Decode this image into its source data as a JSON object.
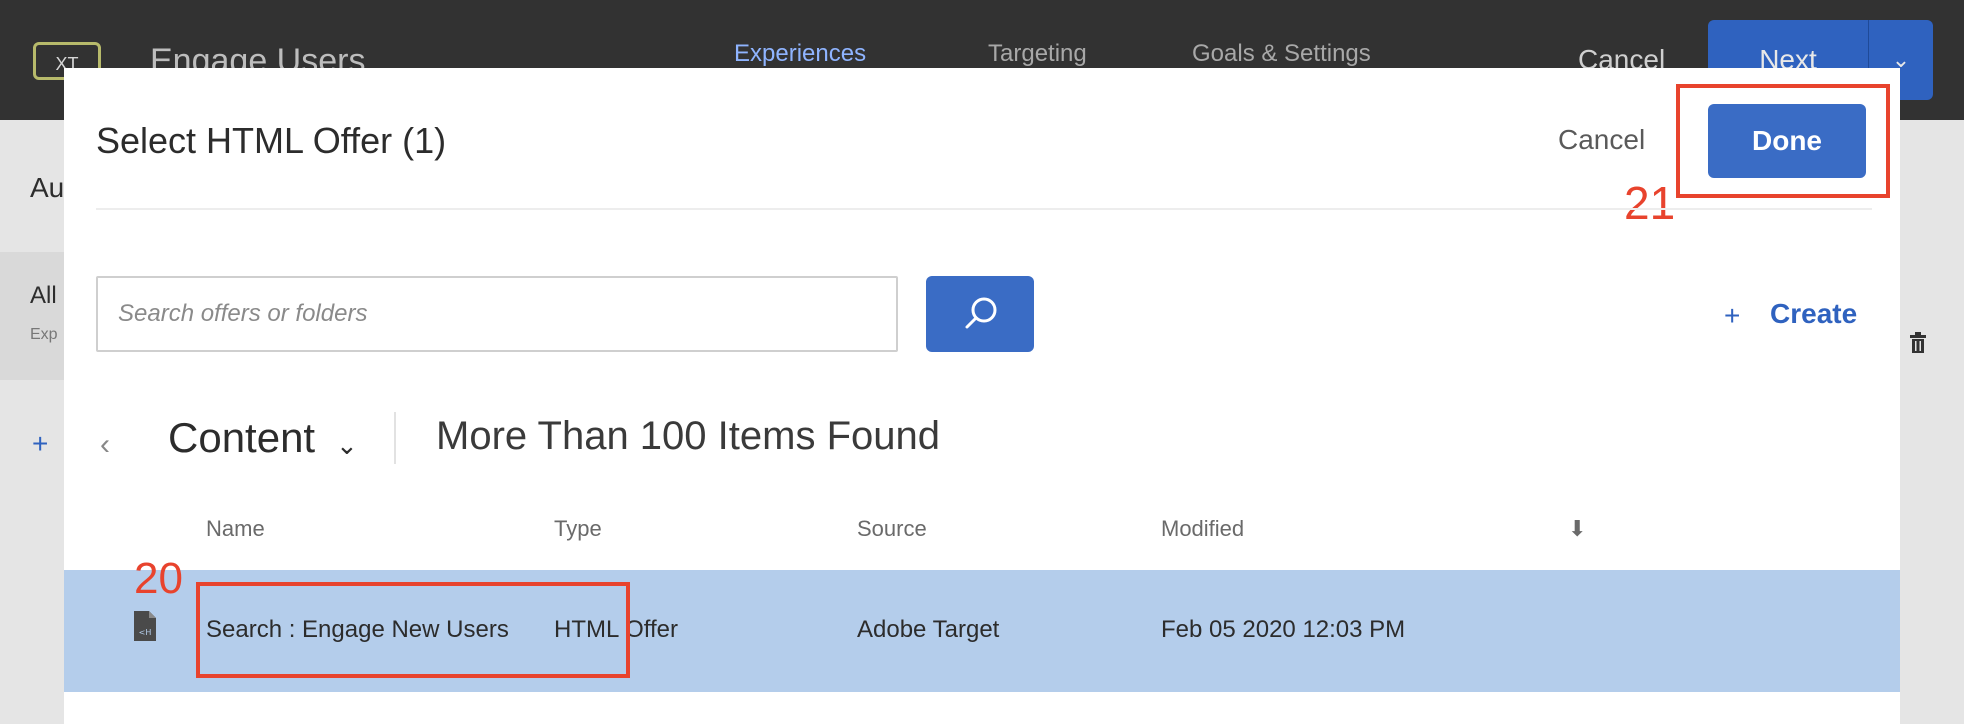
{
  "app": {
    "badge": "XT",
    "title": "Engage Users",
    "tabs": [
      {
        "label": "Experiences",
        "active": true
      },
      {
        "label": "Targeting",
        "active": false
      },
      {
        "label": "Goals & Settings",
        "active": false
      }
    ],
    "cancel": "Cancel",
    "next": "Next"
  },
  "background": {
    "audience_heading": "Au",
    "all_visitors": "All",
    "experience_sub": "Exp"
  },
  "modal": {
    "title": "Select HTML Offer (1)",
    "cancel": "Cancel",
    "done": "Done",
    "search": {
      "placeholder": "Search offers or folders"
    },
    "create": {
      "plus": "+",
      "label": "Create"
    },
    "folder": "Content",
    "items_found": "More Than 100 Items Found",
    "columns": [
      "Name",
      "Type",
      "Source",
      "Modified"
    ],
    "rows": [
      {
        "name": "Search : Engage New Users",
        "type": "HTML Offer",
        "source": "Adobe Target",
        "modified": "Feb 05 2020  12:03 PM",
        "selected": true
      }
    ]
  },
  "annotations": {
    "row_step": "20",
    "done_step": "21"
  },
  "colors": {
    "accent_blue": "#3a6cc5",
    "annotation_red": "#e8432d",
    "selected_row": "#b4cdeb",
    "topbar": "#323232"
  }
}
